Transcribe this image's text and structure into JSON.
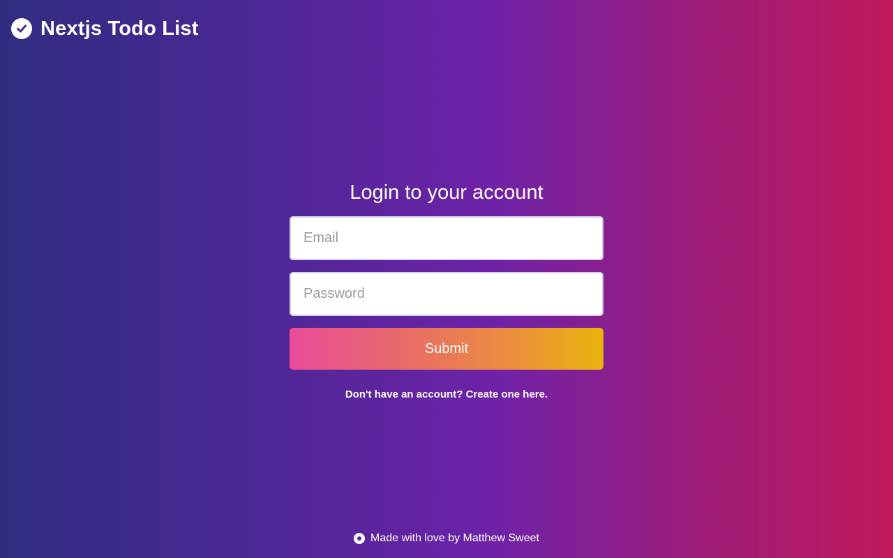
{
  "header": {
    "logo_icon": "check-circle-icon",
    "title": "Nextjs Todo List"
  },
  "login": {
    "heading": "Login to your account",
    "email": {
      "placeholder": "Email",
      "value": ""
    },
    "password": {
      "placeholder": "Password",
      "value": ""
    },
    "submit_label": "Submit",
    "signup_text": "Don't have an account? Create one here."
  },
  "footer": {
    "icon": "github-icon",
    "text": "Made with love by Matthew Sweet"
  },
  "colors": {
    "background_left": "#2f2c80",
    "background_mid": "#6e22a8",
    "background_right": "#c0185a",
    "button_left": "#ea4c9a",
    "button_right": "#eab40c"
  }
}
